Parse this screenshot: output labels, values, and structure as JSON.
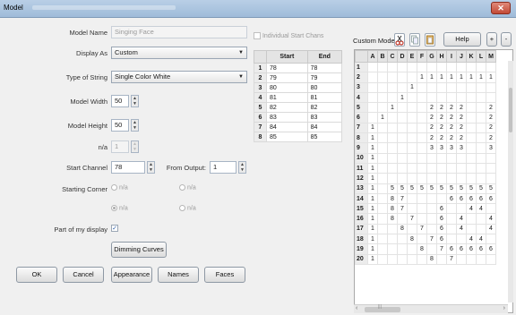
{
  "window": {
    "title": "Model",
    "close": "✕"
  },
  "form": {
    "model_name_label": "Model Name",
    "model_name_value": "Singing Face",
    "display_as_label": "Display As",
    "display_as_value": "Custom",
    "type_of_string_label": "Type of String",
    "type_of_string_value": "Single Color White",
    "model_width_label": "Model Width",
    "model_width_value": "50",
    "model_height_label": "Model Height",
    "model_height_value": "50",
    "na_label": "n/a",
    "na_value": "1",
    "start_channel_label": "Start Channel",
    "start_channel_value": "78",
    "from_output_label": "From Output:",
    "from_output_value": "1",
    "starting_corner_label": "Starting Corner",
    "corner_options": [
      "n/a",
      "n/a",
      "n/a",
      "n/a"
    ],
    "part_of_display_label": "Part of my display",
    "part_of_display_checked": "✓"
  },
  "buttons": {
    "dimming_curves": "Dimming Curves",
    "ok": "OK",
    "cancel": "Cancel",
    "appearance": "Appearance",
    "names": "Names",
    "faces": "Faces",
    "help": "Help",
    "plus": "+",
    "minus": "-"
  },
  "individual_start_chans_label": "Individual Start Chans",
  "start_chans_table": {
    "headers": [
      "",
      "Start",
      "End"
    ],
    "rows": [
      [
        "1",
        "78",
        "78"
      ],
      [
        "2",
        "79",
        "79"
      ],
      [
        "3",
        "80",
        "80"
      ],
      [
        "4",
        "81",
        "81"
      ],
      [
        "5",
        "82",
        "82"
      ],
      [
        "6",
        "83",
        "83"
      ],
      [
        "7",
        "84",
        "84"
      ],
      [
        "8",
        "85",
        "85"
      ]
    ]
  },
  "custom_model": {
    "label": "Custom Model",
    "columns": [
      "A",
      "B",
      "C",
      "D",
      "E",
      "F",
      "G",
      "H",
      "I",
      "J",
      "K",
      "L",
      "M"
    ],
    "rows": [
      {
        "n": "1",
        "cells": [
          "",
          "",
          "",
          "",
          "",
          "",
          "",
          "",
          "",
          "",
          "",
          "",
          ""
        ]
      },
      {
        "n": "2",
        "cells": [
          "",
          "",
          "",
          "",
          "",
          "1",
          "1",
          "1",
          "1",
          "1",
          "1",
          "1",
          "1"
        ]
      },
      {
        "n": "3",
        "cells": [
          "",
          "",
          "",
          "",
          "1",
          "",
          "",
          "",
          "",
          "",
          "",
          "",
          ""
        ]
      },
      {
        "n": "4",
        "cells": [
          "",
          "",
          "",
          "1",
          "",
          "",
          "",
          "",
          "",
          "",
          "",
          "",
          ""
        ]
      },
      {
        "n": "5",
        "cells": [
          "",
          "",
          "1",
          "",
          "",
          "",
          "2",
          "2",
          "2",
          "2",
          "",
          "",
          "2"
        ]
      },
      {
        "n": "6",
        "cells": [
          "",
          "1",
          "",
          "",
          "",
          "",
          "2",
          "2",
          "2",
          "2",
          "",
          "",
          "2"
        ]
      },
      {
        "n": "7",
        "cells": [
          "1",
          "",
          "",
          "",
          "",
          "",
          "2",
          "2",
          "2",
          "2",
          "",
          "",
          "2"
        ]
      },
      {
        "n": "8",
        "cells": [
          "1",
          "",
          "",
          "",
          "",
          "",
          "2",
          "2",
          "2",
          "2",
          "",
          "",
          "2"
        ]
      },
      {
        "n": "9",
        "cells": [
          "1",
          "",
          "",
          "",
          "",
          "",
          "3",
          "3",
          "3",
          "3",
          "",
          "",
          "3"
        ]
      },
      {
        "n": "10",
        "cells": [
          "1",
          "",
          "",
          "",
          "",
          "",
          "",
          "",
          "",
          "",
          "",
          "",
          ""
        ]
      },
      {
        "n": "11",
        "cells": [
          "1",
          "",
          "",
          "",
          "",
          "",
          "",
          "",
          "",
          "",
          "",
          "",
          ""
        ]
      },
      {
        "n": "12",
        "cells": [
          "1",
          "",
          "",
          "",
          "",
          "",
          "",
          "",
          "",
          "",
          "",
          "",
          ""
        ]
      },
      {
        "n": "13",
        "cells": [
          "1",
          "",
          "5",
          "5",
          "5",
          "5",
          "5",
          "5",
          "5",
          "5",
          "5",
          "5",
          "5"
        ]
      },
      {
        "n": "14",
        "cells": [
          "1",
          "",
          "8",
          "7",
          "",
          "",
          "",
          "",
          "6",
          "6",
          "6",
          "6",
          "6"
        ]
      },
      {
        "n": "15",
        "cells": [
          "1",
          "",
          "8",
          "7",
          "",
          "",
          "",
          "6",
          "",
          "",
          "4",
          "4",
          ""
        ]
      },
      {
        "n": "16",
        "cells": [
          "1",
          "",
          "8",
          "",
          "7",
          "",
          "",
          "6",
          "",
          "4",
          "",
          "",
          "4"
        ]
      },
      {
        "n": "17",
        "cells": [
          "1",
          "",
          "",
          "8",
          "",
          "7",
          "",
          "6",
          "",
          "4",
          "",
          "",
          "4"
        ]
      },
      {
        "n": "18",
        "cells": [
          "1",
          "",
          "",
          "",
          "8",
          "",
          "7",
          "6",
          "",
          "",
          "4",
          "4",
          ""
        ]
      },
      {
        "n": "19",
        "cells": [
          "1",
          "",
          "",
          "",
          "",
          "8",
          "",
          "7",
          "6",
          "6",
          "6",
          "6",
          "6"
        ]
      },
      {
        "n": "20",
        "cells": [
          "1",
          "",
          "",
          "",
          "",
          "",
          "8",
          "",
          "7",
          "",
          "",
          "",
          ""
        ]
      }
    ]
  },
  "scroll": {
    "left": "‹",
    "right": "›",
    "grip": "|||"
  }
}
